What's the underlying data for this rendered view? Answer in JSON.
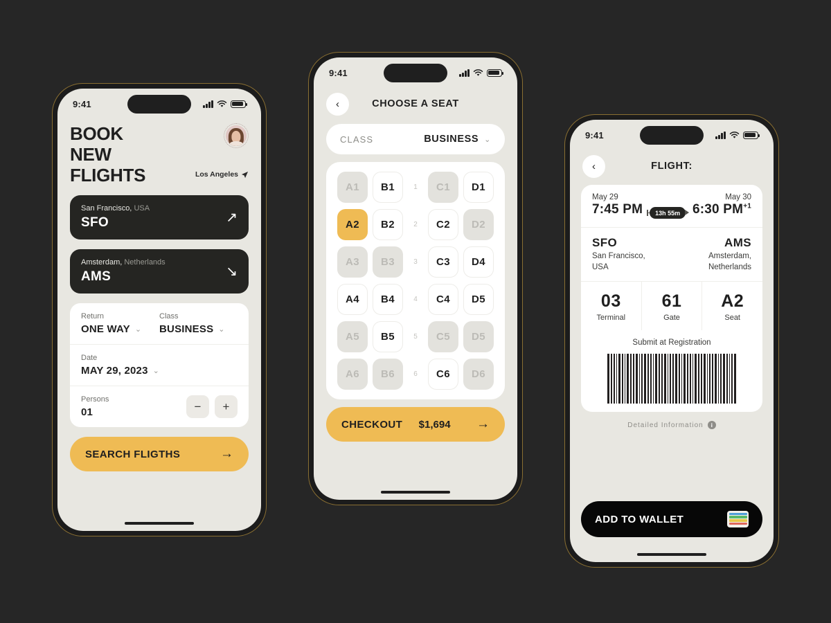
{
  "theme": {
    "background": "#262626",
    "accent": "#EFBB54",
    "dark": "#252522",
    "screen": "#e8e7e1",
    "frame_gold": "#8a6f32"
  },
  "statusbar": {
    "time": "9:41"
  },
  "phone1": {
    "title_lines": [
      "BOOK",
      "NEW",
      "FLIGHTS"
    ],
    "location": "Los Angeles",
    "departure": {
      "city": "San Francisco,",
      "country": "USA",
      "code": "SFO",
      "arrow": "↗"
    },
    "arrival": {
      "city": "Amsterdam,",
      "country": "Netherlands",
      "code": "AMS",
      "arrow": "↘"
    },
    "options": {
      "return_label": "Return",
      "return_value": "ONE WAY",
      "class_label": "Class",
      "class_value": "BUSINESS",
      "date_label": "Date",
      "date_value": "MAY 29, 2023",
      "persons_label": "Persons",
      "persons_value": "01",
      "minus": "−",
      "plus": "+"
    },
    "cta": {
      "label": "SEARCH FLIGTHS",
      "arrow": "→"
    }
  },
  "phone2": {
    "nav_title": "CHOOSE A SEAT",
    "back_icon": "‹",
    "class_label": "CLASS",
    "class_value": "BUSINESS",
    "chevron": "⌄",
    "seat_rows": [
      {
        "number": "1",
        "seats": [
          {
            "label": "A1",
            "state": "taken"
          },
          {
            "label": "B1",
            "state": "free"
          },
          {
            "label": "C1",
            "state": "taken"
          },
          {
            "label": "D1",
            "state": "free"
          }
        ]
      },
      {
        "number": "2",
        "seats": [
          {
            "label": "A2",
            "state": "sel"
          },
          {
            "label": "B2",
            "state": "free"
          },
          {
            "label": "C2",
            "state": "free"
          },
          {
            "label": "D2",
            "state": "taken"
          }
        ]
      },
      {
        "number": "3",
        "seats": [
          {
            "label": "A3",
            "state": "taken"
          },
          {
            "label": "B3",
            "state": "taken"
          },
          {
            "label": "C3",
            "state": "free"
          },
          {
            "label": "D4",
            "state": "free"
          }
        ]
      },
      {
        "number": "4",
        "seats": [
          {
            "label": "A4",
            "state": "free"
          },
          {
            "label": "B4",
            "state": "free"
          },
          {
            "label": "C4",
            "state": "free"
          },
          {
            "label": "D5",
            "state": "free"
          }
        ]
      },
      {
        "number": "5",
        "seats": [
          {
            "label": "A5",
            "state": "taken"
          },
          {
            "label": "B5",
            "state": "free"
          },
          {
            "label": "C5",
            "state": "taken"
          },
          {
            "label": "D5",
            "state": "taken"
          }
        ]
      },
      {
        "number": "6",
        "seats": [
          {
            "label": "A6",
            "state": "taken"
          },
          {
            "label": "B6",
            "state": "taken"
          },
          {
            "label": "C6",
            "state": "free"
          },
          {
            "label": "D6",
            "state": "taken"
          }
        ]
      }
    ],
    "cta": {
      "label": "CHECKOUT",
      "price": "$1,694",
      "arrow": "→"
    }
  },
  "phone3": {
    "nav_title": "FLIGHT:",
    "back_icon": "‹",
    "depart_date": "May 29",
    "depart_time": "7:45 PM",
    "duration": "13h 55m",
    "arrive_date": "May 30",
    "arrive_time": "6:30 PM",
    "arrive_day_offset": "+1",
    "from_code": "SFO",
    "from_city": "San Francisco,",
    "from_country": "USA",
    "to_code": "AMS",
    "to_city": "Amsterdam,",
    "to_country": "Netherlands",
    "stats": [
      {
        "value": "03",
        "label": "Terminal"
      },
      {
        "value": "61",
        "label": "Gate"
      },
      {
        "value": "A2",
        "label": "Seat"
      }
    ],
    "barcode_label": "Submit at Registration",
    "detail_link": "Detailed Information",
    "info_glyph": "i",
    "cta": {
      "label": "ADD TO WALLET"
    },
    "wallet_colors": [
      "#4f9fd8",
      "#5aba6a",
      "#e8c74a",
      "#e0685c"
    ]
  }
}
